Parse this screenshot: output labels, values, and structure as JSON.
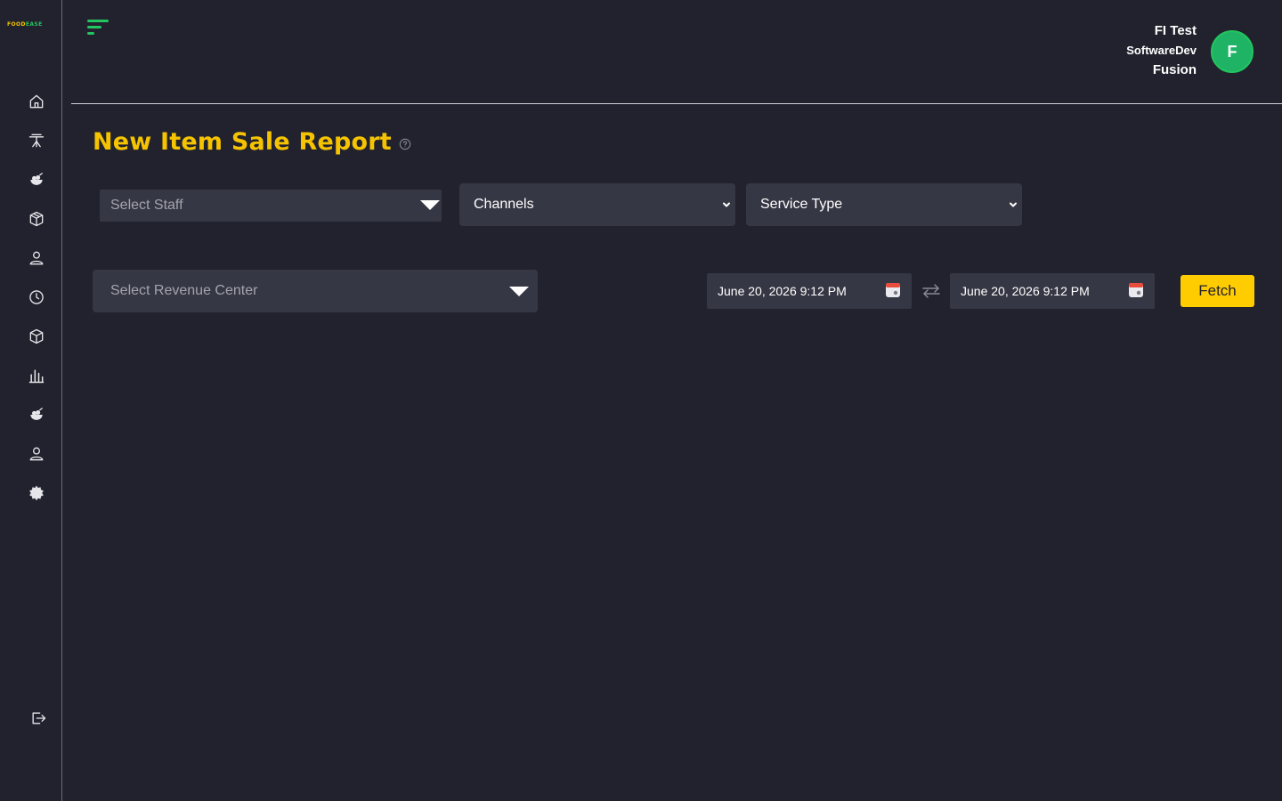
{
  "brand": {
    "logo_food": "FOOD",
    "logo_ease": "EASE"
  },
  "sidebar": {
    "items": [
      {
        "icon": "home-icon"
      },
      {
        "icon": "dining-table-icon"
      },
      {
        "icon": "food-bowl-icon"
      },
      {
        "icon": "package-icon"
      },
      {
        "icon": "user-icon"
      },
      {
        "icon": "clock-icon"
      },
      {
        "icon": "inventory-box-icon"
      },
      {
        "icon": "bar-chart-icon"
      },
      {
        "icon": "menu-items-icon"
      },
      {
        "icon": "staff-user-icon"
      },
      {
        "icon": "settings-gear-icon"
      }
    ],
    "logout_icon": "logout-icon"
  },
  "header": {
    "user_name": "FI Test",
    "user_org": "SoftwareDev",
    "user_sub": "Fusion",
    "avatar_initial": "F"
  },
  "page": {
    "title": "New Item Sale Report"
  },
  "filters": {
    "staff_placeholder": "Select Staff",
    "channels_label": "Channels",
    "service_type_label": "Service Type",
    "revenue_center_placeholder": "Select Revenue Center",
    "date_from": "June 20, 2026 9:12 PM",
    "date_to": "June 20, 2026 9:12 PM",
    "fetch_label": "Fetch"
  },
  "colors": {
    "background": "#22222e",
    "accent_yellow": "#ffcc00",
    "title_yellow": "#f5c300",
    "avatar_green": "#1fb366",
    "field_bg": "#363744"
  }
}
